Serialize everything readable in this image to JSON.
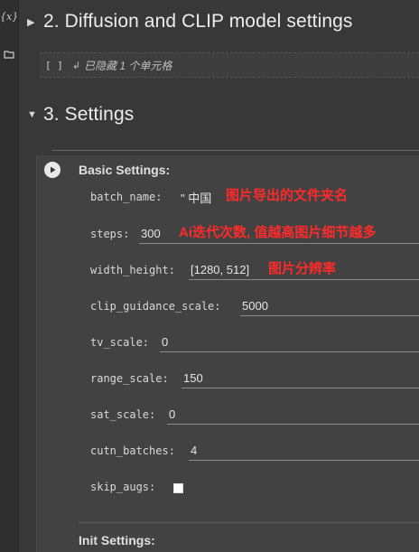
{
  "sidebar": {
    "var_icon_label": "{x}"
  },
  "sections": {
    "diffusion": {
      "title": "2. Diffusion and CLIP model settings"
    },
    "hidden_cell": {
      "brackets": "[ ]",
      "label": "已隐藏 1 个单元格"
    },
    "settings": {
      "title": "3. Settings"
    }
  },
  "form": {
    "basic_title": "Basic Settings:",
    "init_title": "Init Settings:",
    "params": {
      "batch_name": {
        "name": "batch_name",
        "value": "\" 中国"
      },
      "steps": {
        "name": "steps",
        "value": "300"
      },
      "width_height": {
        "name": "width_height",
        "value": "[1280, 512]"
      },
      "clip_guidance_scale": {
        "name": "clip_guidance_scale",
        "value": "5000"
      },
      "tv_scale": {
        "name": "tv_scale",
        "value": "0"
      },
      "range_scale": {
        "name": "range_scale",
        "value": "150"
      },
      "sat_scale": {
        "name": "sat_scale",
        "value": "0"
      },
      "cutn_batches": {
        "name": "cutn_batches",
        "value": "4"
      },
      "skip_augs": {
        "name": "skip_augs",
        "checked": false
      }
    }
  },
  "annotations": {
    "batch_name": "图片导出的文件夹名",
    "steps": "Ai迭代次数, 值越高图片细节越多",
    "width_height": "图片分辨率"
  },
  "colors": {
    "annotation": "#ff2a2a",
    "background": "#383838",
    "cell": "#424242"
  }
}
